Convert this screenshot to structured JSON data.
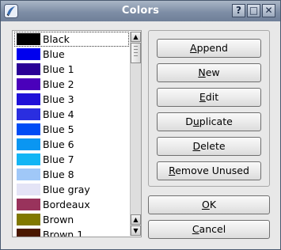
{
  "window": {
    "title": "Colors",
    "help": "?",
    "maximize": "□",
    "close": "✕"
  },
  "colors": [
    {
      "name": "Black",
      "color": "#000000"
    },
    {
      "name": "Blue",
      "color": "#0000ee"
    },
    {
      "name": "Blue 1",
      "color": "#2a0096"
    },
    {
      "name": "Blue 2",
      "color": "#4a00bb"
    },
    {
      "name": "Blue 3",
      "color": "#1f10d8"
    },
    {
      "name": "Blue 4",
      "color": "#2a2ee0"
    },
    {
      "name": "Blue 5",
      "color": "#004cf5"
    },
    {
      "name": "Blue 6",
      "color": "#0a96f2"
    },
    {
      "name": "Blue 7",
      "color": "#12b5f5"
    },
    {
      "name": "Blue 8",
      "color": "#a0c8f8"
    },
    {
      "name": "Blue gray",
      "color": "#e4e4f6"
    },
    {
      "name": "Bordeaux",
      "color": "#99335c"
    },
    {
      "name": "Brown",
      "color": "#807800"
    },
    {
      "name": "Brown 1",
      "color": "#4a1800"
    }
  ],
  "buttons": {
    "append": {
      "label": "Append",
      "mnemonic": "A"
    },
    "new": {
      "label": "New",
      "mnemonic": "N"
    },
    "edit": {
      "label": "Edit",
      "mnemonic": "E"
    },
    "duplicate": {
      "label": "Duplicate",
      "mnemonic": "u"
    },
    "delete": {
      "label": "Delete",
      "mnemonic": "D"
    },
    "remove_unused": {
      "label": "Remove Unused",
      "mnemonic": "R"
    },
    "ok": {
      "label": "OK",
      "mnemonic": "O"
    },
    "cancel": {
      "label": "Cancel",
      "mnemonic": "C"
    }
  },
  "scrollbar": {
    "up": "▲",
    "down": "▼"
  }
}
